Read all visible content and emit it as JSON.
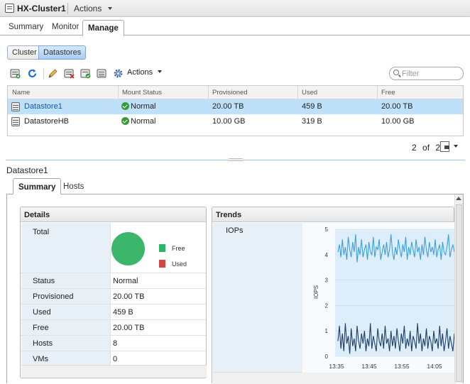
{
  "window": {
    "title": "HX-Cluster1",
    "actions_label": "Actions",
    "icons": [
      "host-icon",
      "chevron-down-icon"
    ]
  },
  "main_tabs": [
    {
      "label": "Summary",
      "active": false
    },
    {
      "label": "Monitor",
      "active": false
    },
    {
      "label": "Manage",
      "active": true
    }
  ],
  "sub_toggle": [
    {
      "label": "Cluster",
      "active": false
    },
    {
      "label": "Datastores",
      "active": true
    }
  ],
  "toolbar": {
    "icons": [
      "new-datastore-icon",
      "refresh-icon",
      "edit-icon",
      "delete-datastore-icon",
      "mount-datastore-icon",
      "unmount-datastore-icon",
      "gear-icon"
    ],
    "actions_label": "Actions",
    "filter_placeholder": "Filter"
  },
  "datastores_table": {
    "columns": [
      "Name",
      "Mount Status",
      "Provisioned",
      "Used",
      "Free"
    ],
    "rows": [
      {
        "name": "Datastore1",
        "mount_status": "Normal",
        "provisioned": "20.00 TB",
        "used": "459 B",
        "free": "20.00 TB",
        "selected": true
      },
      {
        "name": "DatastoreHB",
        "mount_status": "Normal",
        "provisioned": "10.00 GB",
        "used": "319 B",
        "free": "10.00 GB",
        "selected": false
      }
    ]
  },
  "pager": {
    "current": "2",
    "of_label": "of",
    "total": "2"
  },
  "selected_datastore": {
    "title": "Datastore1"
  },
  "detail_tabs": [
    {
      "label": "Summary",
      "active": true
    },
    {
      "label": "Hosts",
      "active": false
    }
  ],
  "details_panel": {
    "title": "Details",
    "total_label": "Total",
    "legend": [
      {
        "label": "Free",
        "color": "#2fb565"
      },
      {
        "label": "Used",
        "color": "#d64545"
      }
    ],
    "rows": [
      {
        "label": "Status",
        "value": "Normal"
      },
      {
        "label": "Provisioned",
        "value": "20.00 TB"
      },
      {
        "label": "Used",
        "value": "459 B"
      },
      {
        "label": "Free",
        "value": "20.00 TB"
      },
      {
        "label": "Hosts",
        "value": "8"
      },
      {
        "label": "VMs",
        "value": "0"
      }
    ]
  },
  "trends_panel": {
    "title": "Trends",
    "metric_label": "IOPs"
  },
  "chart_data": {
    "type": "line",
    "ylabel": "IOPS",
    "ylim": [
      0,
      5
    ],
    "yticks": [
      "5",
      "4",
      "3",
      "2",
      "1",
      "0"
    ],
    "xticks": [
      "13:35",
      "13:45",
      "13:55",
      "14:05"
    ],
    "grid": true,
    "series": [
      {
        "color": "#3aa0e0",
        "values": [
          4.1,
          4.4,
          3.9,
          4.6,
          4.0,
          4.3,
          3.8,
          4.7,
          4.2,
          3.9,
          4.5,
          4.1,
          4.8,
          3.7,
          4.3,
          4.0,
          4.6,
          3.9,
          4.2,
          4.4,
          3.8,
          4.5,
          4.1,
          4.0,
          4.7,
          3.9,
          4.3,
          4.2,
          4.6,
          3.8,
          4.1,
          4.4,
          4.0,
          4.5,
          3.9,
          4.2,
          4.8,
          4.1,
          3.8,
          4.3,
          4.0,
          4.6,
          4.2,
          3.9,
          4.4,
          4.1,
          4.7,
          3.8,
          4.3,
          4.0,
          4.5,
          4.2,
          3.9,
          4.6,
          4.1,
          4.3,
          3.8,
          4.4,
          4.0,
          4.7,
          4.2,
          3.9,
          4.5,
          4.1,
          4.3,
          4.0,
          4.6,
          3.9,
          4.2,
          4.4,
          3.8,
          4.5,
          4.1,
          4.0,
          4.3,
          4.8,
          3.9,
          4.2,
          4.4,
          4.1
        ]
      },
      {
        "color": "#1d3d63",
        "values": [
          0.6,
          1.2,
          0.3,
          0.9,
          0.2,
          1.3,
          0.5,
          0.8,
          0.1,
          1.1,
          0.4,
          0.7,
          0.2,
          1.2,
          0.6,
          0.3,
          0.9,
          0.5,
          1.0,
          0.2,
          0.7,
          0.4,
          1.3,
          0.3,
          0.8,
          0.5,
          0.2,
          1.1,
          0.6,
          0.4,
          0.9,
          0.3,
          1.2,
          0.5,
          0.7,
          0.2,
          1.0,
          0.4,
          0.8,
          0.3,
          1.1,
          0.6,
          0.2,
          0.9,
          0.5,
          1.2,
          0.3,
          0.7,
          0.4,
          1.0,
          0.2,
          0.8,
          0.6,
          0.3,
          1.3,
          0.5,
          0.9,
          0.2,
          0.7,
          0.4,
          1.1,
          0.3,
          0.8,
          0.6,
          0.2,
          1.0,
          0.5,
          0.7,
          0.3,
          1.2,
          0.4,
          0.9,
          0.2,
          0.6,
          1.1,
          0.3,
          0.8,
          0.5,
          0.2,
          0.9
        ]
      }
    ]
  }
}
